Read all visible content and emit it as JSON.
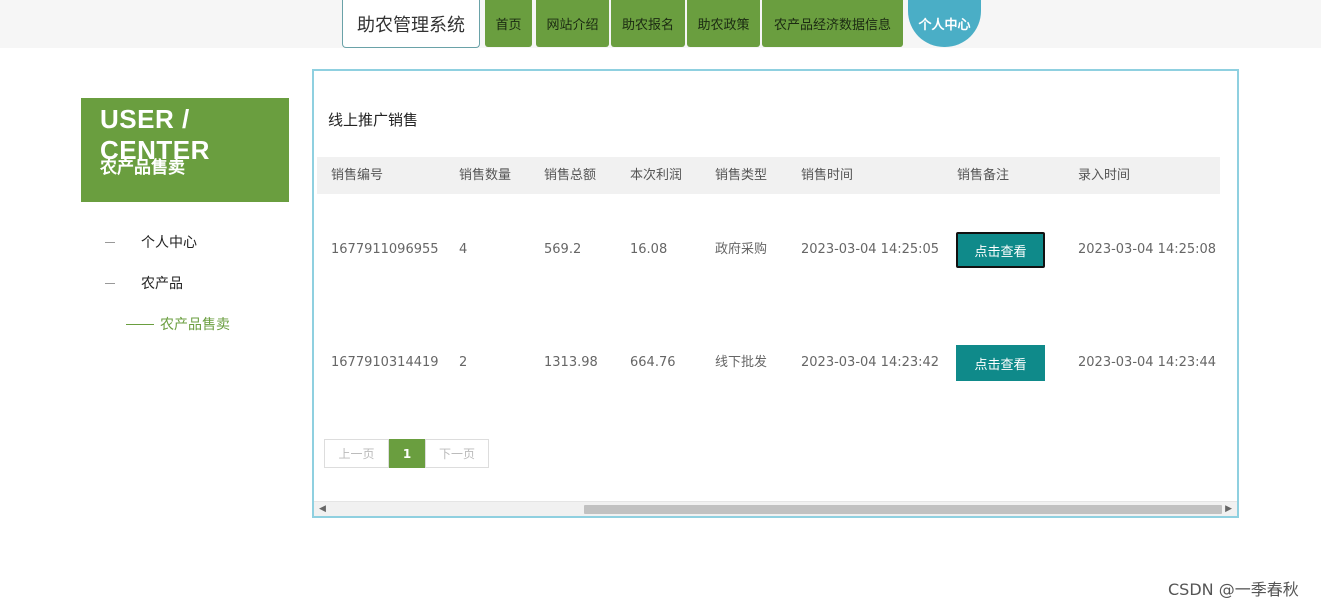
{
  "header": {
    "brand": "助农管理系统",
    "nav": [
      {
        "label": "首页"
      },
      {
        "label": "网站介绍"
      },
      {
        "label": "助农报名"
      },
      {
        "label": "助农政策"
      },
      {
        "label": "农产品经济数据信息"
      },
      {
        "label": "个人中心",
        "active": true
      }
    ]
  },
  "sidebar": {
    "title": "USER / CENTER",
    "subtitle": "农产品售卖",
    "items": [
      {
        "label": "个人中心"
      },
      {
        "label": "农产品"
      }
    ],
    "sub_item": {
      "label": "农产品售卖"
    }
  },
  "main": {
    "section_title": "线上推广销售",
    "columns": [
      "销售编号",
      "销售数量",
      "销售总额",
      "本次利润",
      "销售类型",
      "销售时间",
      "销售备注",
      "录入时间"
    ],
    "rows": [
      {
        "id": "1677911096955",
        "qty": "4",
        "total": "569.2",
        "profit": "16.08",
        "type": "政府采购",
        "sale_time": "2023-03-04 14:25:05",
        "action": "点击查看",
        "entry_time": "2023-03-04 14:25:08"
      },
      {
        "id": "1677910314419",
        "qty": "2",
        "total": "1313.98",
        "profit": "664.76",
        "type": "线下批发",
        "sale_time": "2023-03-04 14:23:42",
        "action": "点击查看",
        "entry_time": "2023-03-04 14:23:44"
      }
    ],
    "pager": {
      "prev": "上一页",
      "current": "1",
      "next": "下一页"
    }
  },
  "watermark": "CSDN @一季春秋",
  "colors": {
    "brand_green": "#6a9e3f",
    "teal_button": "#0f8a8a",
    "active_nav": "#4aaec6",
    "panel_border": "#8fd0e0"
  }
}
